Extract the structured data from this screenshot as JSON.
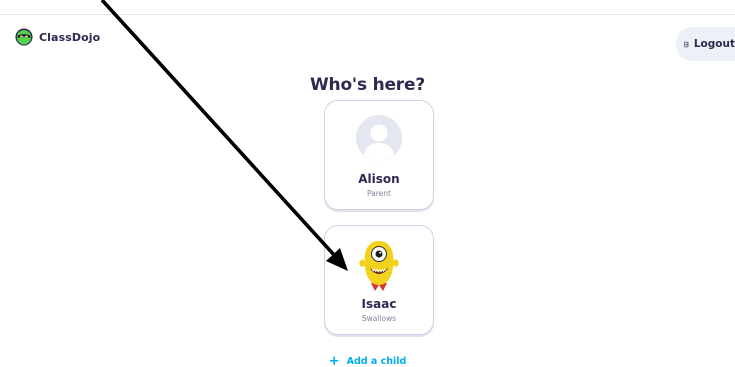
{
  "app": {
    "brand_name": "ClassDojo",
    "logo_icon": "classdojo-logo-icon",
    "colors": {
      "heading": "#2c2a50",
      "accent": "#00aeef",
      "card_border": "#cfd2e6",
      "logout_bg": "#eef0f8",
      "monster_body": "#f2d21c"
    }
  },
  "header": {
    "logout_label": "Logout",
    "logout_icon": "logout-door-icon"
  },
  "main": {
    "heading": "Who's here?",
    "profiles": [
      {
        "name": "Alison",
        "role": "Parent",
        "avatar": "default-person-avatar-icon"
      },
      {
        "name": "Isaac",
        "role": "Swallows",
        "avatar": "yellow-monster-avatar-icon"
      }
    ],
    "add_child": {
      "icon": "plus-icon",
      "label": "Add a child"
    }
  },
  "overlay": {
    "annotation": "black-arrow-icon"
  }
}
